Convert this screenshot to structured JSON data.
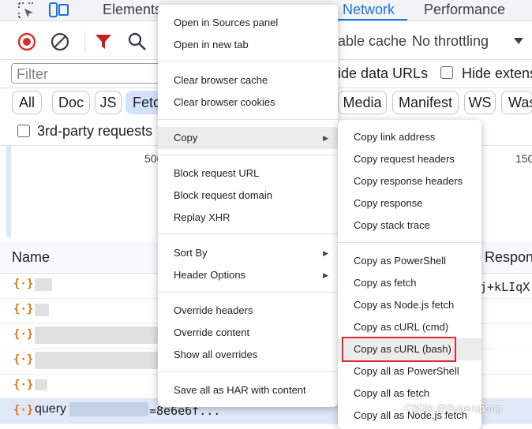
{
  "tabs": {
    "elements": "Elements",
    "network": "Network",
    "performance": "Performance"
  },
  "toolbar": {
    "cache": "able cache",
    "throttling": "No throttling"
  },
  "filter": {
    "placeholder": "Filter",
    "hide_data_urls": "ide data URLs",
    "hide_extensions": "Hide extens"
  },
  "chips": [
    "All",
    "Doc",
    "JS",
    "Fetc",
    "Media",
    "Manifest",
    "WS",
    "Was"
  ],
  "third_party": "3rd-party requests",
  "overview": {
    "tick_500": "500",
    "tick_150": "150"
  },
  "table": {
    "name_header": "Name",
    "response_header": "Respons",
    "response_value": "j+kLIqX",
    "last_row_name": "query",
    "last_row_suffix": "=8e6e6f..."
  },
  "context_menu": {
    "items": {
      "open_sources": "Open in Sources panel",
      "open_tab": "Open in new tab",
      "clear_cache": "Clear browser cache",
      "clear_cookies": "Clear browser cookies",
      "copy": "Copy",
      "block_url": "Block request URL",
      "block_domain": "Block request domain",
      "replay_xhr": "Replay XHR",
      "sort_by": "Sort By",
      "header_options": "Header Options",
      "override_headers": "Override headers",
      "override_content": "Override content",
      "show_overrides": "Show all overrides",
      "save_har": "Save all as HAR with content"
    }
  },
  "copy_menu": {
    "items": {
      "link_address": "Copy link address",
      "request_headers": "Copy request headers",
      "response_headers": "Copy response headers",
      "response": "Copy response",
      "stack_trace": "Copy stack trace",
      "powershell": "Copy as PowerShell",
      "fetch": "Copy as fetch",
      "node_fetch": "Copy as Node.js fetch",
      "curl_cmd": "Copy as cURL (cmd)",
      "curl_bash": "Copy as cURL (bash)",
      "all_powershell": "Copy all as PowerShell",
      "all_fetch": "Copy all as fetch",
      "all_node_fetch": "Copy all as Node.js fetch"
    }
  },
  "watermark": "CSDN @Superxpang",
  "colors": {
    "accent": "#1a73e8",
    "record": "#d93025",
    "filter": "#c5221f",
    "highlight_border": "#e0282c",
    "xhr_icon": "#e37400"
  },
  "icons": [
    "inspect-icon",
    "device-toolbar-icon",
    "record-icon",
    "clear-icon",
    "filter-icon",
    "search-icon",
    "dropdown-icon",
    "xhr-icon",
    "submenu-arrow-icon"
  ]
}
